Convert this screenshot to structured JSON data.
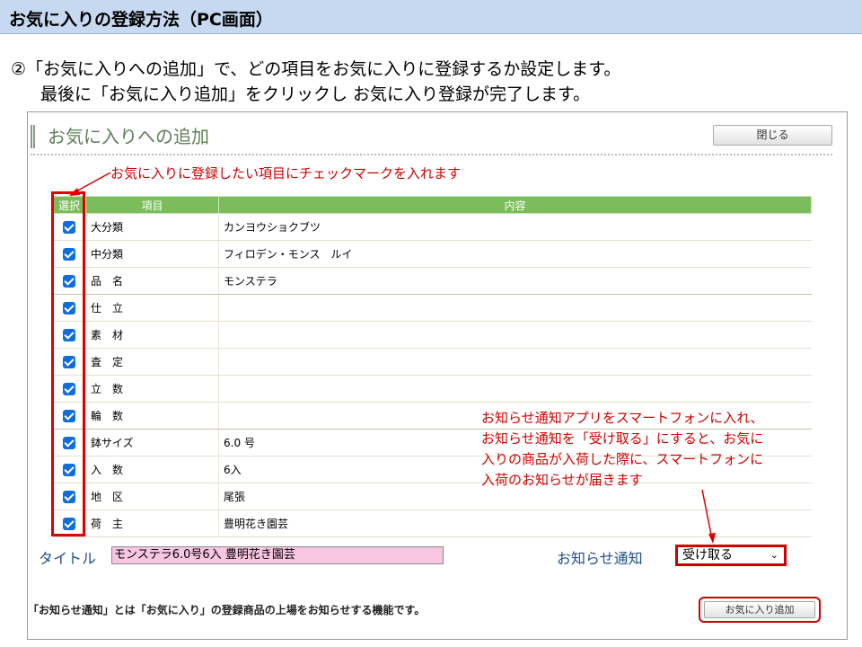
{
  "slide": {
    "header": "お気に入りの登録方法（PC画面）",
    "instruction_line1": "②「お気に入りへの追加」で、どの項目をお気に入りに登録するか設定します。",
    "instruction_line2": "最後に「お気に入り追加」をクリックし お気に入り登録が完了します。"
  },
  "panel": {
    "title": "お気に入りへの追加",
    "close_label": "閉じる",
    "annotation_top": "お気に入りに登録したい項目にチェックマークを入れます",
    "annotation_right": [
      "お知らせ通知アプリをスマートフォンに入れ、",
      "お知らせ通知を「受け取る」にすると、お気に",
      "入りの商品が入荷した際に、スマートフォンに",
      "入荷のお知らせが届きます"
    ]
  },
  "table": {
    "headers": [
      "選択",
      "項目",
      "内容"
    ],
    "rows": [
      {
        "item": "大分類",
        "value": "カンヨウショクブツ",
        "checked": true
      },
      {
        "item": "中分類",
        "value": "フィロデン・モンス　ルイ",
        "checked": true
      },
      {
        "item": "品　名",
        "value": "モンステラ",
        "checked": true
      },
      {
        "item": "仕　立",
        "value": "",
        "checked": true
      },
      {
        "item": "素　材",
        "value": "",
        "checked": true
      },
      {
        "item": "査　定",
        "value": "",
        "checked": true
      },
      {
        "item": "立　数",
        "value": "",
        "checked": true
      },
      {
        "item": "輪　数",
        "value": "",
        "checked": true
      },
      {
        "item": "鉢サイズ",
        "value": "6.0 号",
        "checked": true
      },
      {
        "item": "入　数",
        "value": "6入",
        "checked": true
      },
      {
        "item": "地　区",
        "value": "尾張",
        "checked": true
      },
      {
        "item": "荷　主",
        "value": "豊明花き園芸",
        "checked": true
      }
    ]
  },
  "form": {
    "title_label": "タイトル",
    "title_value": "モンステラ6.0号6入 豊明花き園芸",
    "notify_label": "お知らせ通知",
    "notify_value": "受け取る",
    "footer_note": "「お知らせ通知」とは「お気に入り」の登録商品の上場をお知らせする機能です。",
    "add_button": "お気に入り追加"
  },
  "colors": {
    "header_bg": "#c6d9f1",
    "table_header": "#7bbd5a",
    "annotation": "#d00000",
    "label_blue": "#1f4e8a",
    "title_field_bg": "#f9c6e2"
  }
}
